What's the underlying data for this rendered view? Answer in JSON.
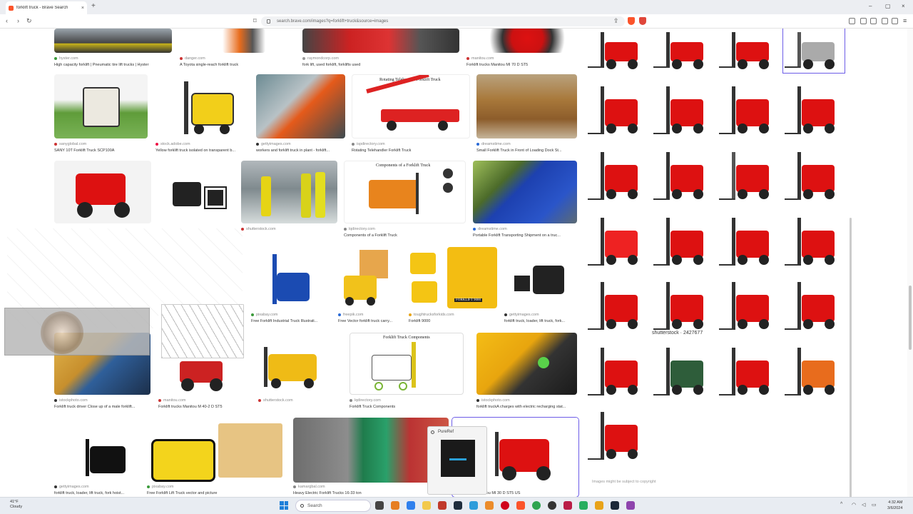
{
  "browser": {
    "tab_title": "forklift truck - Brave Search",
    "tab_close": "×",
    "new_tab": "+",
    "url": "search.brave.com/images?q=forklift+truck&source=images",
    "window_controls": [
      "–",
      "▢",
      "×"
    ]
  },
  "results": [
    {
      "source": "hyster.com",
      "caption": "High capacity forklift | Pneumatic tire lift trucks | Hyster"
    },
    {
      "source": "danger.com",
      "caption": "A Toyota single-reach forklift truck"
    },
    {
      "source": "raymondcorp.com",
      "caption": "fork lift, used forklift, forklifts used"
    },
    {
      "source": "manitou.com",
      "caption": "Forklift trucks Manitou MI 70 D ST5"
    },
    {
      "source": "sanyglobal.com",
      "caption": "SANY 10T Forklift Truck SCP100A"
    },
    {
      "source": "stock.adobe.com",
      "caption": "Yellow forklift truck isolated on transparent b..."
    },
    {
      "source": "gettyimages.com",
      "caption": "workers and forklift truck in plant - forklift..."
    },
    {
      "source": "ispdirectory.com",
      "caption": "Rotating Telehandler Forklift Truck"
    },
    {
      "source": "dreamstime.com",
      "caption": "Small Forklift Truck in Front of Loading Dock St..."
    },
    {
      "source": "shutterstock.com",
      "caption": ""
    },
    {
      "source": "lqdirectory.com",
      "caption": "Components of a Forklift Truck"
    },
    {
      "source": "dreamstime.com",
      "caption": "Portable Forklift Transporting Shipment on a truc..."
    },
    {
      "source": "pixabay.com",
      "caption": "Free Forklift Industrial Truck Illustrati..."
    },
    {
      "source": "freepik.com",
      "caption": "Free Vector forklift truck carry..."
    },
    {
      "source": "toughtrucksforkids.com",
      "caption": "Forklift 9000"
    },
    {
      "source": "gettyimages.com",
      "caption": "forklift truck, loader, lift truck, fork..."
    },
    {
      "source": "istockphoto.com",
      "caption": "Forklift truck driver Close up of a male forklift..."
    },
    {
      "source": "manitou.com",
      "caption": "Forklift trucks Manitou M 40-2 D ST5"
    },
    {
      "source": "shutterstock.com",
      "caption": ""
    },
    {
      "source": "lqdirectory.com",
      "caption": "Forklift Truck Components"
    },
    {
      "source": "istockphoto.com",
      "caption": "forklift truckA charges with electric recharging stat..."
    },
    {
      "source": "gettyimages.com",
      "caption": "forklift truck, loader, lift truck, fork hoist..."
    },
    {
      "source": "pixabay.com",
      "caption": "Free Forklift Lift Truck vector and picture"
    },
    {
      "source": "kamargbal.com",
      "caption": "Heavy Electric Forklift Trucks 16-33 ton"
    },
    {
      "source": "",
      "caption": "Forklift trucks Manitou MI 30 D ST5 US"
    }
  ],
  "thumb_texts": {
    "rotating": "Rotating Telehandler Forklift Truck",
    "components": "Components of a Forklift Truck",
    "components2": "Forklift Truck Components",
    "toy": "FORKLIFT 9000",
    "shutter": "shutterstock · 2427677"
  },
  "pureref_title": "PureRef",
  "disclaimer": "Images might be subject to copyright",
  "taskbar": {
    "temp": "41°F",
    "cond": "Cloudy",
    "search": "Search",
    "time": "4:32 AM",
    "date": "3/6/2024"
  }
}
